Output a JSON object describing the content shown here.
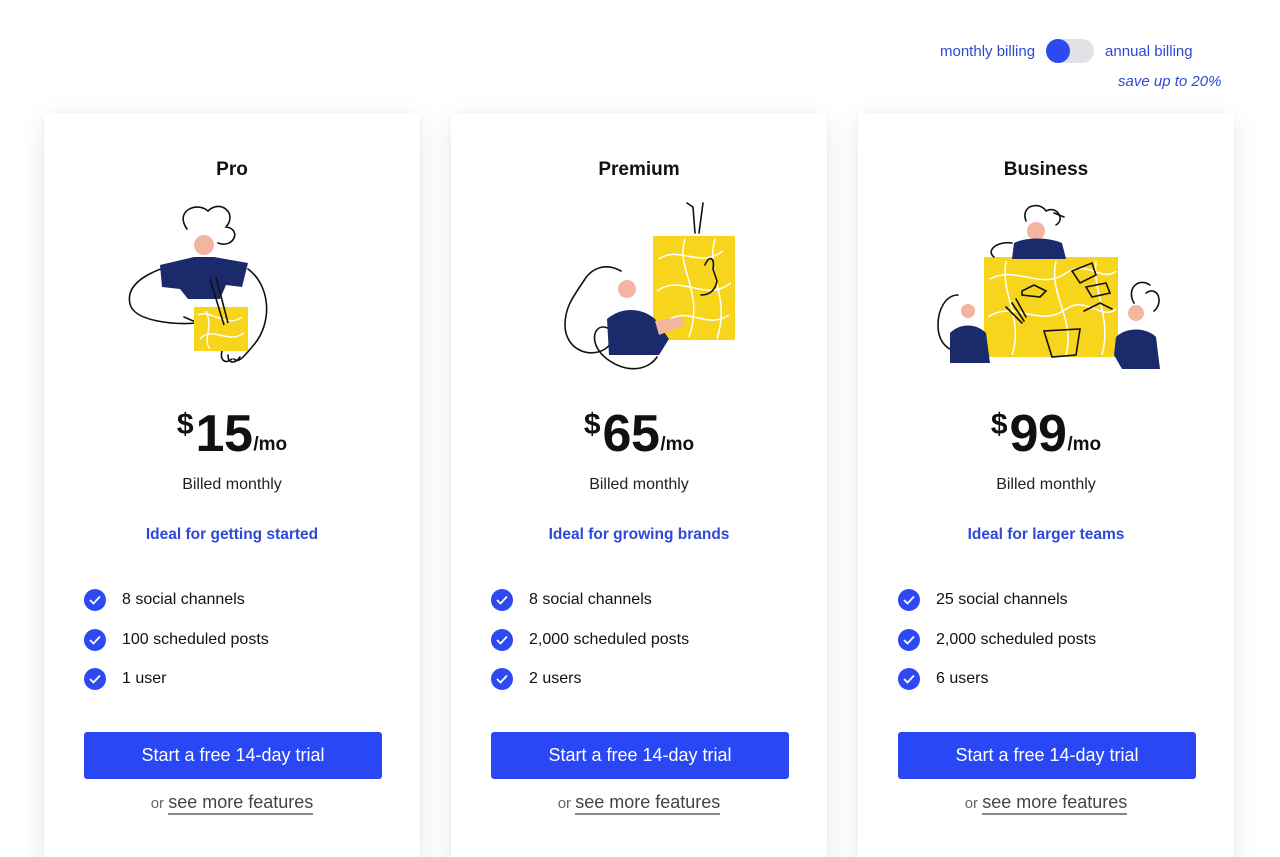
{
  "billing": {
    "monthly_label": "monthly billing",
    "annual_label": "annual billing",
    "save_note": "save up to 20%",
    "toggle_state": "monthly"
  },
  "colors": {
    "accent": "#2a47f5",
    "accent_text": "#2e49d6",
    "illustration_yellow": "#f7d51c",
    "illustration_navy": "#1b2a6b"
  },
  "plans": [
    {
      "name": "Pro",
      "illustration": "person-holding-box-illustration",
      "currency": "$",
      "amount": "15",
      "per": "/mo",
      "billed": "Billed monthly",
      "tagline": "Ideal for getting started",
      "features": [
        "8 social channels",
        "100 scheduled posts",
        "1 user"
      ],
      "cta": "Start a free 14-day trial",
      "more_prefix": "or",
      "more_link": "see more features"
    },
    {
      "name": "Premium",
      "illustration": "person-pointing-at-board-illustration",
      "currency": "$",
      "amount": "65",
      "per": "/mo",
      "billed": "Billed monthly",
      "tagline": "Ideal for growing brands",
      "features": [
        "8 social channels",
        "2,000 scheduled posts",
        "2 users"
      ],
      "cta": "Start a free 14-day trial",
      "more_prefix": "or",
      "more_link": "see more features"
    },
    {
      "name": "Business",
      "illustration": "team-around-board-illustration",
      "currency": "$",
      "amount": "99",
      "per": "/mo",
      "billed": "Billed monthly",
      "tagline": "Ideal for larger teams",
      "features": [
        "25 social channels",
        "2,000 scheduled posts",
        "6 users"
      ],
      "cta": "Start a free 14-day trial",
      "more_prefix": "or",
      "more_link": "see more features"
    }
  ]
}
